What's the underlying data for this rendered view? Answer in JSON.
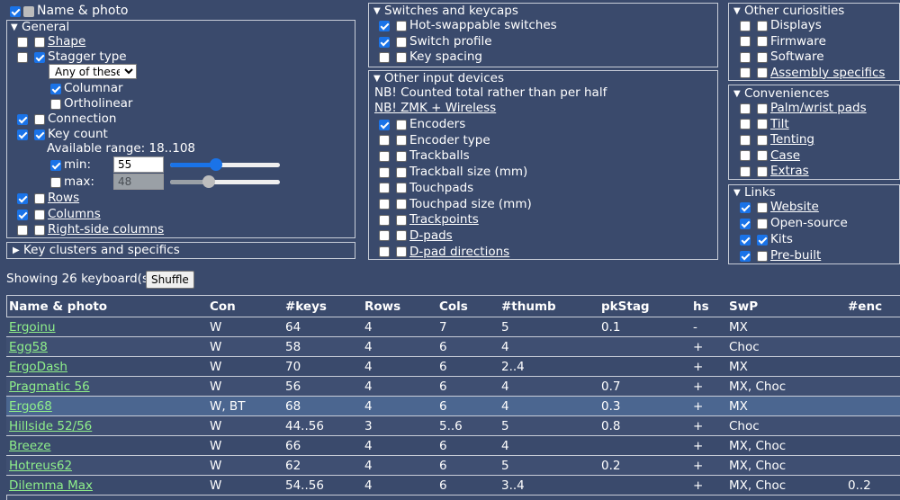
{
  "top": {
    "name_photo": "Name & photo"
  },
  "general": {
    "title": "General",
    "shape": "Shape",
    "stagger_type": "Stagger type",
    "stagger_select": "Any of these",
    "columnar": "Columnar",
    "ortholinear": "Ortholinear",
    "connection": "Connection",
    "key_count": "Key count",
    "range": "Available range: 18..108",
    "min_label": "min:",
    "max_label": "max:",
    "min_value": "55",
    "max_value": "48",
    "rows": "Rows",
    "columns": "Columns",
    "right_side": "Right-side columns"
  },
  "key_range": {
    "min": 18,
    "max": 108,
    "min_slider": 55,
    "max_slider": 48
  },
  "key_clusters": "Key clusters and specifics",
  "switches": {
    "title": "Switches and keycaps",
    "hot_swap": "Hot-swappable switches",
    "switch_profile": "Switch profile",
    "key_spacing": "Key spacing"
  },
  "input_devices": {
    "title": "Other input devices",
    "note1": "NB! Counted total rather than per half",
    "note2": "NB! ZMK + Wireless",
    "items": [
      "Encoders",
      "Encoder type",
      "Trackballs",
      "Trackball size (mm)",
      "Touchpads",
      "Touchpad size (mm)",
      "Trackpoints",
      "D-pads",
      "D-pad directions"
    ]
  },
  "curiosities": {
    "title": "Other curiosities",
    "items": [
      "Displays",
      "Firmware",
      "Software",
      "Assembly specifics"
    ]
  },
  "conveniences": {
    "title": "Conveniences",
    "items": [
      "Palm/wrist pads",
      "Tilt",
      "Tenting",
      "Case",
      "Extras"
    ]
  },
  "links": {
    "title": "Links",
    "items": [
      "Website",
      "Open-source",
      "Kits",
      "Pre-built"
    ]
  },
  "showing": "Showing 26 keyboard(s)",
  "shuffle": "Shuffle",
  "table": {
    "headers": [
      "Name & photo",
      "Con",
      "#keys",
      "Rows",
      "Cols",
      "#thumb",
      "pkStag",
      "hs",
      "SwP",
      "#enc"
    ],
    "rows": [
      [
        "Ergoinu",
        "W",
        "64",
        "4",
        "7",
        "5",
        "0.1",
        "-",
        "MX",
        ""
      ],
      [
        "Egg58",
        "W",
        "58",
        "4",
        "6",
        "4",
        "",
        "+",
        "Choc",
        ""
      ],
      [
        "ErgoDash",
        "W",
        "70",
        "4",
        "6",
        "2..4",
        "",
        "+",
        "MX",
        ""
      ],
      [
        "Pragmatic 56",
        "W",
        "56",
        "4",
        "6",
        "4",
        "0.7",
        "+",
        "MX, Choc",
        ""
      ],
      [
        "Ergo68",
        "W, BT",
        "68",
        "4",
        "6",
        "4",
        "0.3",
        "+",
        "MX",
        ""
      ],
      [
        "Hillside 52/56",
        "W",
        "44..56",
        "3",
        "5..6",
        "5",
        "0.8",
        "+",
        "Choc",
        ""
      ],
      [
        "Breeze",
        "W",
        "66",
        "4",
        "6",
        "4",
        "",
        "+",
        "MX, Choc",
        ""
      ],
      [
        "Hotreus62",
        "W",
        "62",
        "4",
        "6",
        "5",
        "0.2",
        "+",
        "MX, Choc",
        ""
      ],
      [
        "Dilemma Max",
        "W",
        "54..56",
        "4",
        "6",
        "3..4",
        "",
        "+",
        "MX, Choc",
        "0..2"
      ]
    ]
  }
}
